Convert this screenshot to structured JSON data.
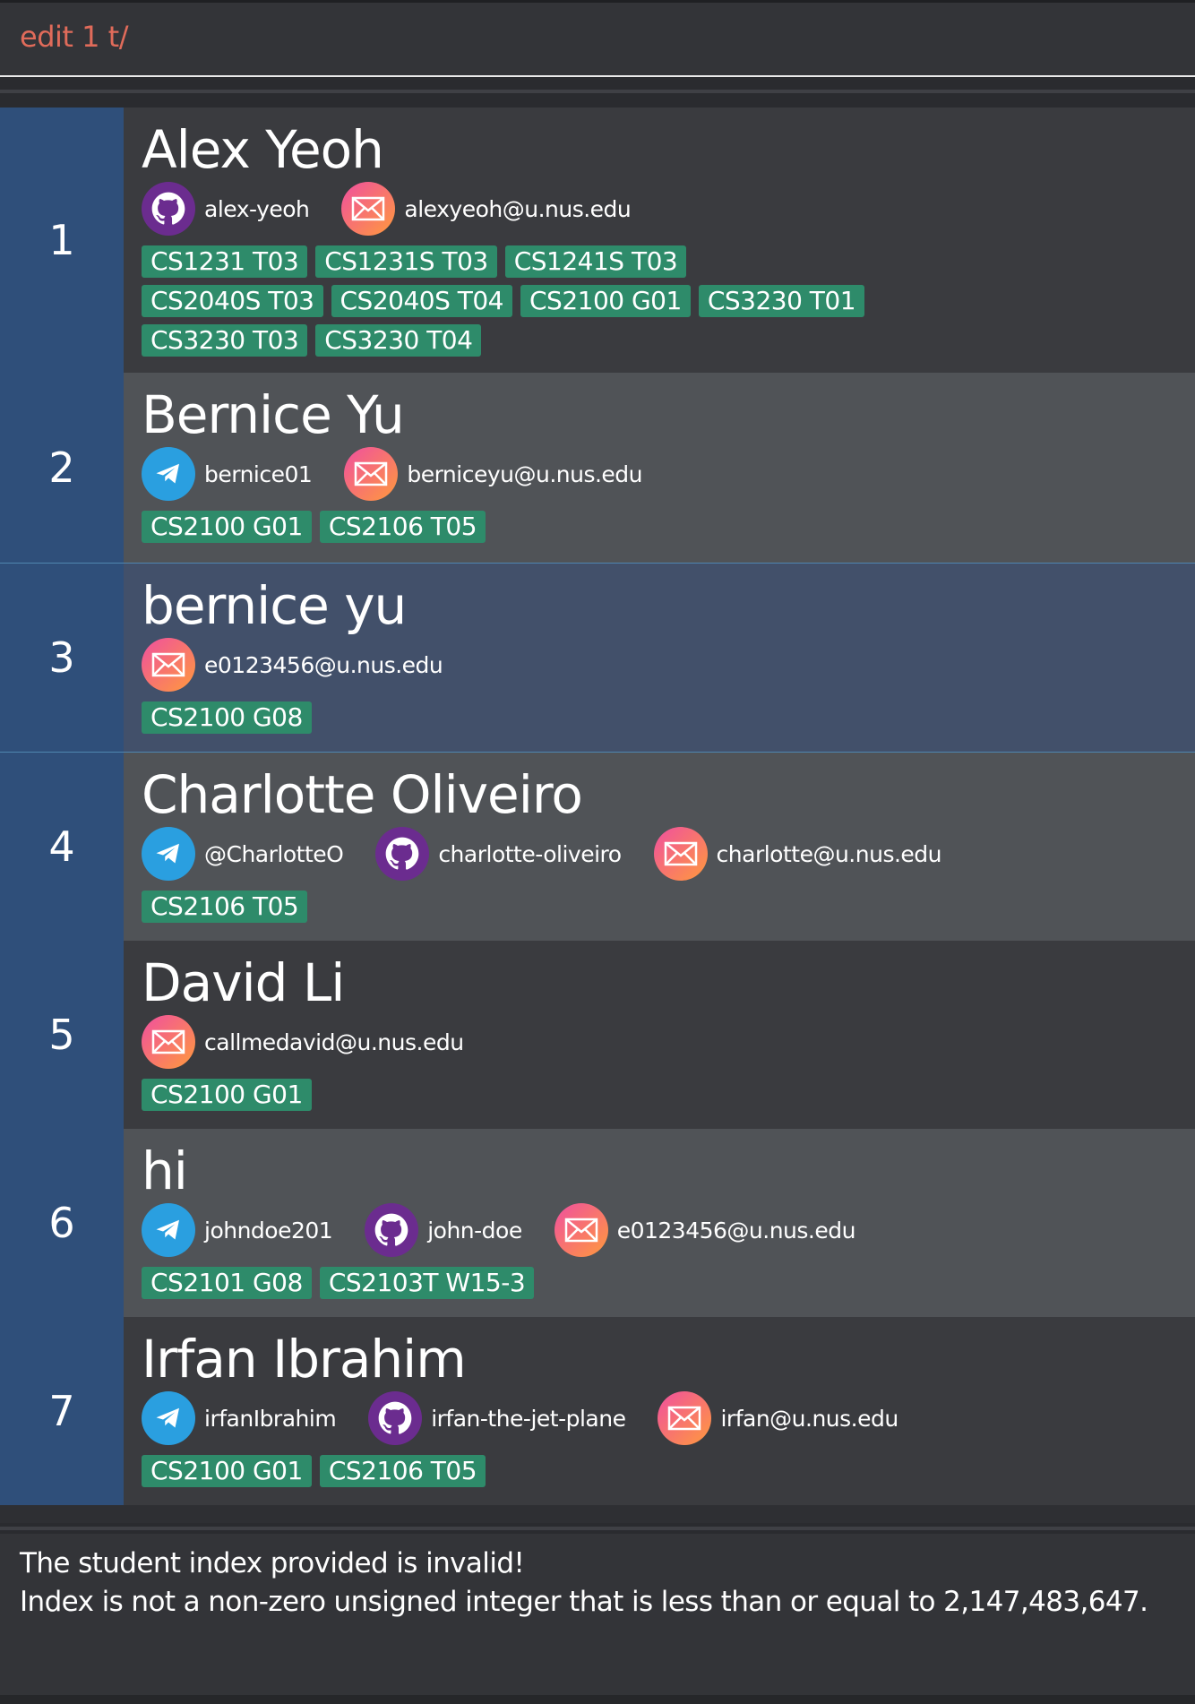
{
  "command_box": {
    "value": "edit 1 t/"
  },
  "persons": [
    {
      "index": "1",
      "name": "Alex Yeoh",
      "contacts": [
        {
          "type": "github",
          "icon": "github-icon",
          "value": "alex-yeoh"
        },
        {
          "type": "email",
          "icon": "email-icon",
          "value": "alexyeoh@u.nus.edu"
        }
      ],
      "tags": [
        "CS1231 T03",
        "CS1231S T03",
        "CS1241S T03",
        "CS2040S T03",
        "CS2040S T04",
        "CS2100 G01",
        "CS3230 T01",
        "CS3230 T03",
        "CS3230 T04"
      ]
    },
    {
      "index": "2",
      "name": "Bernice Yu",
      "contacts": [
        {
          "type": "telegram",
          "icon": "telegram-icon",
          "value": "bernice01"
        },
        {
          "type": "email",
          "icon": "email-icon",
          "value": "berniceyu@u.nus.edu"
        }
      ],
      "tags": [
        "CS2100 G01",
        "CS2106 T05"
      ]
    },
    {
      "index": "3",
      "name": "bernice yu",
      "contacts": [
        {
          "type": "email",
          "icon": "email-icon",
          "value": "e0123456@u.nus.edu"
        }
      ],
      "tags": [
        "CS2100 G08"
      ]
    },
    {
      "index": "4",
      "name": "Charlotte Oliveiro",
      "contacts": [
        {
          "type": "telegram",
          "icon": "telegram-icon",
          "value": "@CharlotteO"
        },
        {
          "type": "github",
          "icon": "github-icon",
          "value": "charlotte-oliveiro"
        },
        {
          "type": "email",
          "icon": "email-icon",
          "value": "charlotte@u.nus.edu"
        }
      ],
      "tags": [
        "CS2106 T05"
      ]
    },
    {
      "index": "5",
      "name": "David Li",
      "contacts": [
        {
          "type": "email",
          "icon": "email-icon",
          "value": "callmedavid@u.nus.edu"
        }
      ],
      "tags": [
        "CS2100 G01"
      ]
    },
    {
      "index": "6",
      "name": "hi",
      "contacts": [
        {
          "type": "telegram",
          "icon": "telegram-icon",
          "value": "johndoe201"
        },
        {
          "type": "github",
          "icon": "github-icon",
          "value": "john-doe"
        },
        {
          "type": "email",
          "icon": "email-icon",
          "value": "e0123456@u.nus.edu"
        }
      ],
      "tags": [
        "CS2101 G08",
        "CS2103T W15-3"
      ]
    },
    {
      "index": "7",
      "name": "Irfan Ibrahim",
      "contacts": [
        {
          "type": "telegram",
          "icon": "telegram-icon",
          "value": "irfanIbrahim"
        },
        {
          "type": "github",
          "icon": "github-icon",
          "value": "irfan-the-jet-plane"
        },
        {
          "type": "email",
          "icon": "email-icon",
          "value": "irfan@u.nus.edu"
        }
      ],
      "tags": [
        "CS2100 G01",
        "CS2106 T05"
      ]
    }
  ],
  "result_display": {
    "line1": "The student index provided is invalid!",
    "line2": "Index is not a non-zero unsigned integer that is less than or equal to 2,147,483,647."
  },
  "colors": {
    "command_text": "#e06b5a",
    "index_panel": "#2f4f7a",
    "tag": "#2e8b6a",
    "selected_border": "#4f86b0"
  }
}
